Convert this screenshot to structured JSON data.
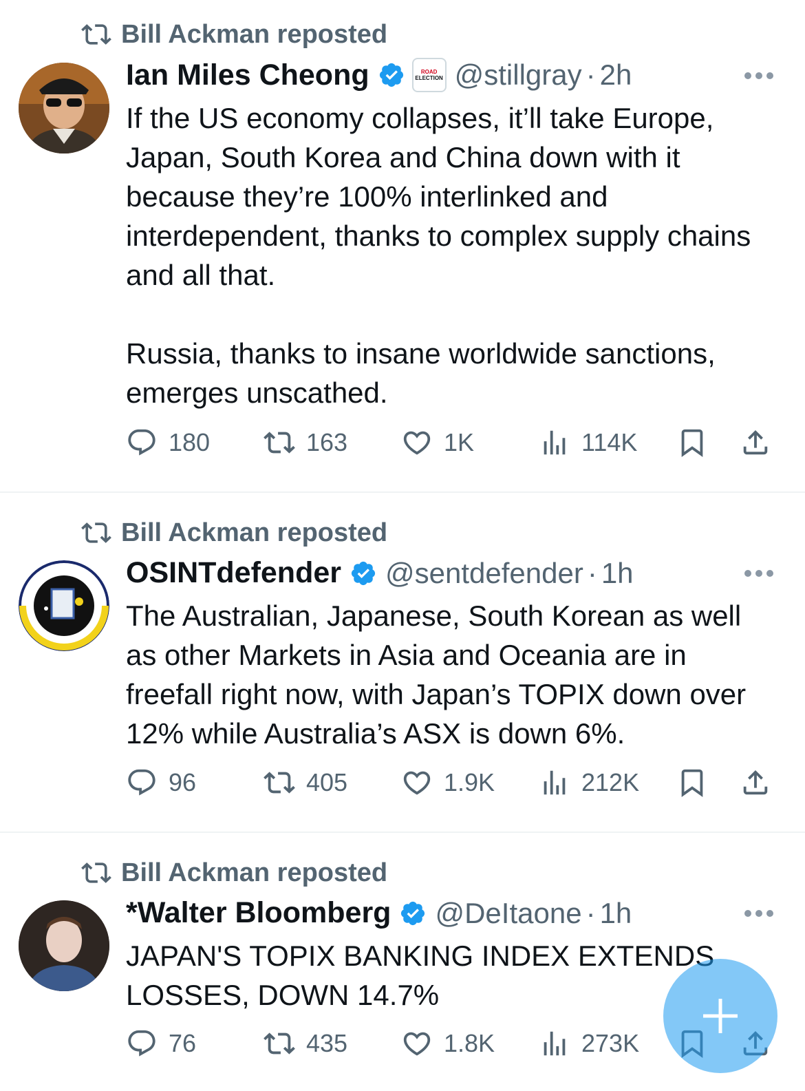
{
  "tweets": [
    {
      "reposted_by": "Bill Ackman reposted",
      "name": "Ian Miles Cheong",
      "affiliation_badge": [
        "ROAD",
        "ELECTION"
      ],
      "handle": "@stillgray",
      "separator": "·",
      "time": "2h",
      "text": "If the US economy collapses, it’ll take Europe, Japan, South Korea and China down with it because they’re 100% interlinked and interdependent, thanks to complex supply chains and all that.\n\nRussia, thanks to insane worldwide sanctions, emerges unscathed.",
      "replies": "180",
      "reposts": "163",
      "likes": "1K",
      "views": "114K"
    },
    {
      "reposted_by": "Bill Ackman reposted",
      "name": "OSINTdefender",
      "handle": "@sentdefender",
      "separator": "·",
      "time": "1h",
      "text": "The Australian, Japanese, South Korean as well as other Markets in Asia and Oceania are in freefall right now, with Japan’s TOPIX down over 12% while Australia’s ASX is down 6%.",
      "replies": "96",
      "reposts": "405",
      "likes": "1.9K",
      "views": "212K"
    },
    {
      "reposted_by": "Bill Ackman reposted",
      "name": "*Walter Bloomberg",
      "handle": "@DeItaone",
      "separator": "·",
      "time": "1h",
      "text": "JAPAN'S TOPIX BANKING INDEX EXTENDS LOSSES, DOWN 14.7%",
      "replies": "76",
      "reposts": "435",
      "likes": "1.8K",
      "views": "273K"
    }
  ],
  "colors": {
    "verified": "#1d9bf0",
    "secondary_text": "#536471",
    "fab": "#1d9bf0"
  }
}
